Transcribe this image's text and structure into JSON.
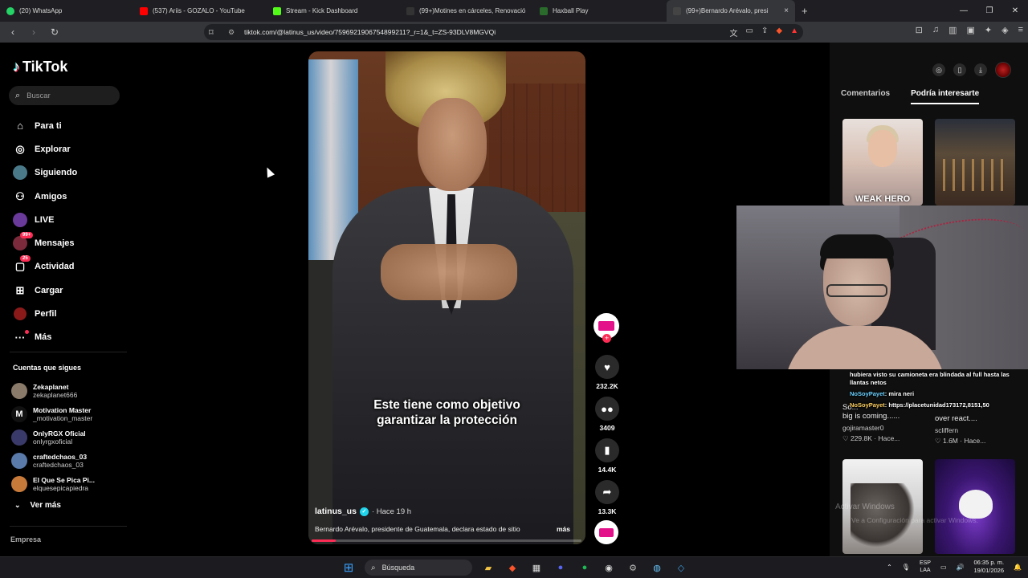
{
  "browser": {
    "tabs": [
      {
        "label": "(20) WhatsApp",
        "color": "#25d366"
      },
      {
        "label": "(537) Ariis - GOZALO - YouTube",
        "color": "#ff0000"
      },
      {
        "label": "Stream - Kick Dashboard",
        "color": "#53fc18"
      },
      {
        "label": "(99+)Motines en cárceles, Renovació",
        "color": "#111111"
      },
      {
        "label": "Haxball Play",
        "color": "#2a6a2a"
      },
      {
        "label": "(99+)Bernardo Arévalo, presi",
        "color": "#111111"
      }
    ],
    "url": "tiktok.com/@latinus_us/video/7596921906754899211?_r=1&_t=ZS-93DLV8MGVQi",
    "close_tab": "×",
    "new_tab": "+"
  },
  "sidebar": {
    "logo": "TikTok",
    "search_placeholder": "Buscar",
    "nav": [
      {
        "label": "Para ti",
        "icon": "home-icon",
        "glyph": "⌂"
      },
      {
        "label": "Explorar",
        "icon": "compass-icon",
        "glyph": "◎"
      },
      {
        "label": "Siguiendo",
        "icon": "following-avatar-icon",
        "glyph": "●"
      },
      {
        "label": "Amigos",
        "icon": "friends-icon",
        "glyph": "👥"
      },
      {
        "label": "LIVE",
        "icon": "live-icon",
        "glyph": "●"
      },
      {
        "label": "Mensajes",
        "icon": "messages-icon",
        "glyph": "✈",
        "badge": "99+"
      },
      {
        "label": "Actividad",
        "icon": "activity-icon",
        "glyph": "▢",
        "badge": "25"
      },
      {
        "label": "Cargar",
        "icon": "upload-icon",
        "glyph": "⊞"
      },
      {
        "label": "Perfil",
        "icon": "profile-avatar-icon",
        "glyph": "●"
      },
      {
        "label": "Más",
        "icon": "more-icon",
        "glyph": "···"
      }
    ],
    "following_title": "Cuentas que sigues",
    "following": [
      {
        "name": "Zekaplanet",
        "user": "zekaplanet666",
        "color": "#8a7a6a"
      },
      {
        "name": "Motivation Master",
        "user": "_motivation_master",
        "color": "#222222"
      },
      {
        "name": "OnlyRGX Oficial",
        "user": "onlyrgxoficial",
        "color": "#3a3a6a"
      },
      {
        "name": "craftedchaos_03",
        "user": "craftedchaos_03",
        "color": "#5a7aaa"
      },
      {
        "name": "El Que Se Pica Pi...",
        "user": "elquesepicapiedra",
        "color": "#c87a3a"
      }
    ],
    "see_more": "Ver más",
    "empresa": "Empresa"
  },
  "video": {
    "caption_line1": "Este tiene como objetivo",
    "caption_line2": "garantizar la protección",
    "username": "latinus_us",
    "time": "· Hace 19 h",
    "description": "Bernardo Arévalo, presidente de Guatemala, declara estado de sitio",
    "more": "más",
    "progress": 0.09
  },
  "actions": {
    "likes": "232.2K",
    "comments": "3409",
    "saves": "14.4K",
    "shares": "13.3K"
  },
  "right_panel": {
    "tab_comments": "Comentarios",
    "tab_interesting": "Podría interesarte",
    "items": [
      {
        "thumb_label": "WEAK HERO",
        "title": "So...",
        "extra": "big is coming......",
        "by": "gojiramaster0",
        "stats": "♡ 229.8K · Hace..."
      },
      {
        "thumb_label": "",
        "title": "",
        "extra": "over react....",
        "by": "scliffern",
        "stats": "♡ 1.6M · Hace..."
      }
    ],
    "watermark": "Activar Windows",
    "watermark2": "Ve a Configuración para activar Windows."
  },
  "stream_chat": {
    "line1": "hubiera visto su camioneta era blindada al full hasta las llantas netos",
    "user1": "NoSoyPayet",
    "msg1": ": mira neri",
    "user2": "NoSoyPayet",
    "msg2": ": https://placetunidad173172,8151,50"
  },
  "taskbar": {
    "search": "Búsqueda",
    "lang1": "ESP",
    "lang2": "LAA",
    "time": "06:35 p. m.",
    "date": "19/01/2026"
  }
}
